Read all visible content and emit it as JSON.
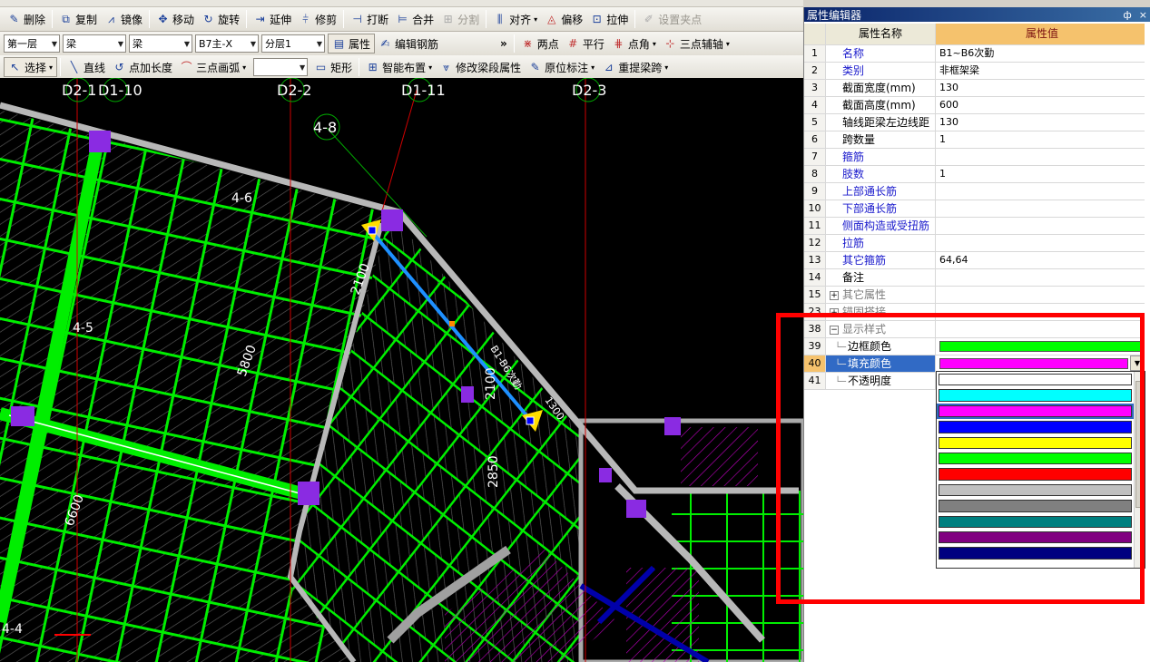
{
  "toolbar1": {
    "delete": "删除",
    "copy": "复制",
    "mirror": "镜像",
    "move": "移动",
    "rotate": "旋转",
    "extend": "延伸",
    "trim": "修剪",
    "break": "打断",
    "merge": "合并",
    "split": "分割",
    "align": "对齐",
    "offset": "偏移",
    "stretch": "拉伸",
    "set_grip": "设置夹点"
  },
  "toolbar2": {
    "floor": "第一层",
    "category": "梁",
    "type": "梁",
    "component": "B7主-X",
    "layer": "分层1",
    "properties": "属性",
    "edit_rebar": "编辑钢筋",
    "two_points": "两点",
    "parallel": "平行",
    "point_angle": "点角",
    "three_point_axis": "三点辅轴",
    "more": "»"
  },
  "toolbar3": {
    "select": "选择",
    "line": "直线",
    "point_extend": "点加长度",
    "arc": "三点画弧",
    "combo_empty": "",
    "rect": "矩形",
    "smart_layout": "智能布置",
    "modify_span": "修改梁段属性",
    "origin_mark": "原位标注",
    "re_extract_span": "重提梁跨",
    "more": "»"
  },
  "canvas": {
    "axis_labels": [
      "D2-1",
      "D1-10",
      "D2-2",
      "D1-11",
      "D2-3",
      "4-8",
      "4-6",
      "4-5",
      "4-4"
    ],
    "dimensions": [
      "5800",
      "2100",
      "2100",
      "1300",
      "2850",
      "6600"
    ],
    "beam_tag": "B1-B6次勤"
  },
  "panel": {
    "title": "属性编辑器",
    "pin": "ф",
    "close": "×",
    "header": {
      "name": "属性名称",
      "value": "属性值"
    },
    "rows": [
      {
        "n": "1",
        "k": "名称",
        "v": "B1~B6次勤",
        "style": "blue"
      },
      {
        "n": "2",
        "k": "类别",
        "v": "非框架梁",
        "style": "blue"
      },
      {
        "n": "3",
        "k": "截面宽度(mm)",
        "v": "130",
        "style": ""
      },
      {
        "n": "4",
        "k": "截面高度(mm)",
        "v": "600",
        "style": ""
      },
      {
        "n": "5",
        "k": "轴线距梁左边线距",
        "v": "130",
        "style": ""
      },
      {
        "n": "6",
        "k": "跨数量",
        "v": "1",
        "style": ""
      },
      {
        "n": "7",
        "k": "箍筋",
        "v": "",
        "style": "blue"
      },
      {
        "n": "8",
        "k": "肢数",
        "v": "1",
        "style": "blue"
      },
      {
        "n": "9",
        "k": "上部通长筋",
        "v": "",
        "style": "blue"
      },
      {
        "n": "10",
        "k": "下部通长筋",
        "v": "",
        "style": "blue"
      },
      {
        "n": "11",
        "k": "侧面构造或受扭筋",
        "v": "",
        "style": "blue"
      },
      {
        "n": "12",
        "k": "拉筋",
        "v": "",
        "style": "blue"
      },
      {
        "n": "13",
        "k": "其它箍筋",
        "v": "64,64",
        "style": "blue"
      },
      {
        "n": "14",
        "k": "备注",
        "v": "",
        "style": ""
      },
      {
        "n": "15",
        "k": "其它属性",
        "v": "",
        "style": "grey"
      },
      {
        "n": "23",
        "k": "锚固搭接",
        "v": "",
        "style": "grey"
      }
    ],
    "display": {
      "group_n": "38",
      "group_label": "显示样式",
      "border_n": "39",
      "border_label": "边框颜色",
      "border_color": "#00ff00",
      "fill_n": "40",
      "fill_label": "填充颜色",
      "fill_color": "#ff00ff",
      "opacity_n": "41",
      "opacity_label": "不透明度",
      "opacity_value": ""
    },
    "color_options": [
      "#ffffff",
      "#00ffff",
      "#ff00ff",
      "#0000ff",
      "#ffff00",
      "#00ff00",
      "#ff0000",
      "#c0c0c0",
      "#808080",
      "#008080",
      "#800080",
      "#000080"
    ],
    "selected_color": "#ff00ff"
  }
}
